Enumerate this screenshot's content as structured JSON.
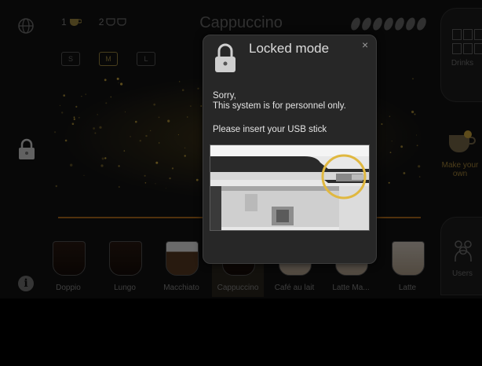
{
  "header": {
    "title": "Cappuccino",
    "cup_options": [
      {
        "count": "1",
        "icon": "single-cup-icon"
      },
      {
        "count": "2",
        "icon": "double-cup-icon"
      }
    ],
    "strength_beans": 7,
    "sizes": [
      {
        "label": "S",
        "active": false
      },
      {
        "label": "M",
        "active": true
      },
      {
        "label": "L",
        "active": false
      }
    ]
  },
  "drinks": [
    {
      "label": "Doppio",
      "style": "dark"
    },
    {
      "label": "Lungo",
      "style": "dark"
    },
    {
      "label": "Macchiato",
      "style": "milk"
    },
    {
      "label": "Cappuccino",
      "style": "dark",
      "selected": true
    },
    {
      "label": "Café au lait",
      "style": "light"
    },
    {
      "label": "Latte Ma...",
      "style": "light"
    },
    {
      "label": "Latte",
      "style": "light"
    }
  ],
  "right_panel": {
    "drinks_label": "Drinks",
    "make_own_label": "Make your own",
    "users_label": "Users"
  },
  "dialog": {
    "title": "Locked mode",
    "close_symbol": "×",
    "line1": "Sorry,",
    "line2": "This system is for personnel only.",
    "line3": "Please insert your USB stick"
  },
  "colors": {
    "accent": "#a9883a",
    "highlight_ring": "#e0b840",
    "divider": "#b46e1e"
  }
}
